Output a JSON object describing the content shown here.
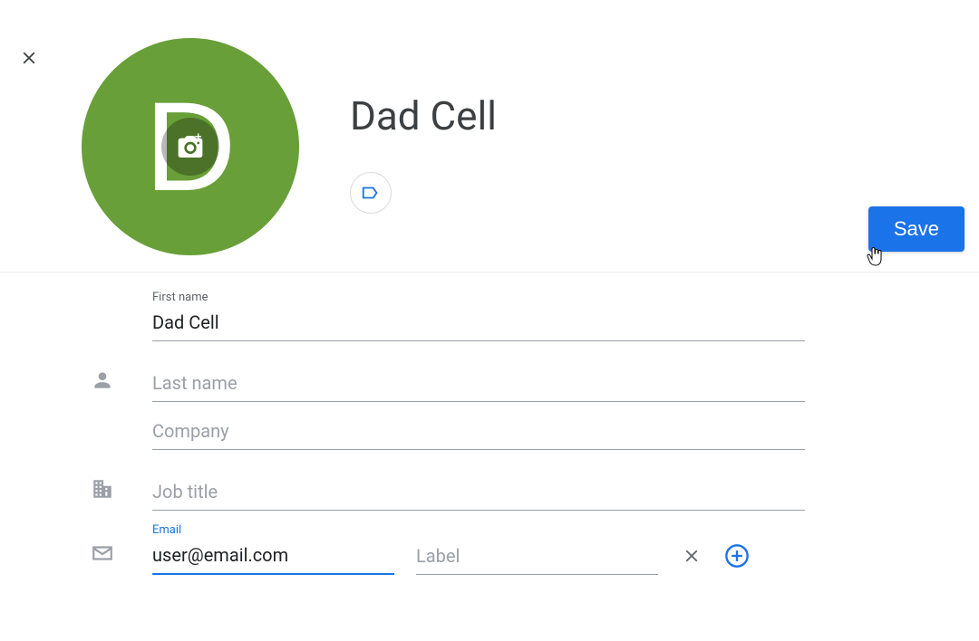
{
  "contact": {
    "display_name": "Dad Cell",
    "avatar_letter": "D",
    "avatar_bg": "#689f38"
  },
  "actions": {
    "save_label": "Save"
  },
  "fields": {
    "first_name": {
      "label": "First name",
      "value": "Dad Cell"
    },
    "last_name": {
      "label": "",
      "placeholder": "Last name",
      "value": ""
    },
    "company": {
      "label": "",
      "placeholder": "Company",
      "value": ""
    },
    "job_title": {
      "label": "",
      "placeholder": "Job title",
      "value": ""
    },
    "email": {
      "label": "Email",
      "value": "user@email.com",
      "label_placeholder": "Label"
    }
  }
}
